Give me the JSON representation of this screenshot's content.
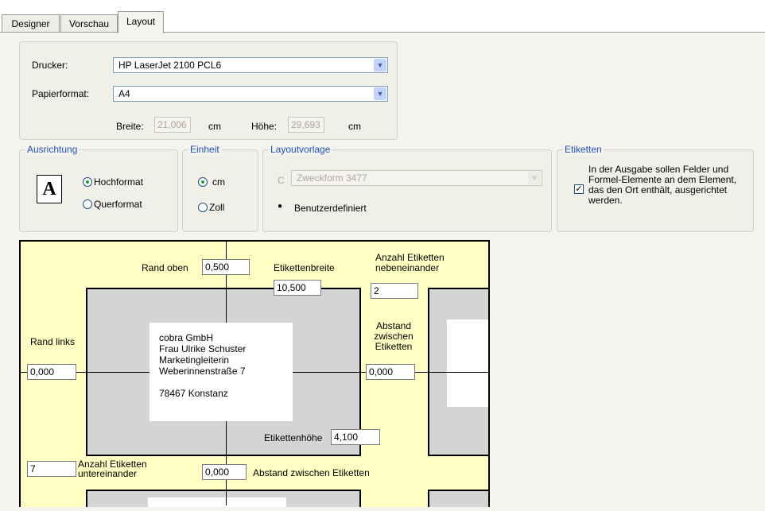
{
  "tabs": [
    "Designer",
    "Vorschau",
    "Layout"
  ],
  "printer": {
    "drucker_label": "Drucker:",
    "drucker_value": "HP LaserJet 2100 PCL6",
    "papier_label": "Papierformat:",
    "papier_value": "A4",
    "breite_label": "Breite:",
    "breite_value": "21,006",
    "hoehe_label": "Höhe:",
    "hoehe_value": "29,693",
    "unit1": "cm",
    "unit2": "cm"
  },
  "ausrichtung": {
    "title": "Ausrichtung",
    "icon_letter": "A",
    "hochformat": "Hochformat",
    "querformat": "Querformat"
  },
  "einheit": {
    "title": "Einheit",
    "cm": "cm",
    "zoll": "Zoll"
  },
  "layoutvorlage": {
    "title": "Layoutvorlage",
    "template_value": "Zweckform 3477",
    "custom": "Benutzerdefiniert"
  },
  "etiketten": {
    "title": "Etiketten",
    "text": "In der Ausgabe sollen Felder und Formel-Elemente an dem Element, das den Ort enthält, ausgerichtet werden."
  },
  "preview": {
    "rand_oben_label": "Rand oben",
    "rand_oben_value": "0,500",
    "etikettenbreite_label": "Etikettenbreite",
    "etikettenbreite_value": "10,500",
    "anzahl_neben_label": "Anzahl Etiketten nebeneinander",
    "anzahl_neben_value": "2",
    "rand_links_label": "Rand links",
    "rand_links_value": "0,000",
    "abstand_label": "Abstand zwischen Etiketten",
    "abstand_value": "0,000",
    "address": [
      "cobra GmbH",
      "Frau Ulrike Schuster",
      "Marketingleiterin",
      "Weberinnenstraße 7",
      "",
      "78467 Konstanz"
    ],
    "etikettenhoehe_label": "Etikettenhöhe",
    "etikettenhoehe_value": "4,100",
    "anzahl_unter_value": "7",
    "anzahl_unter_label": "Anzahl Etiketten untereinander",
    "abstand_vert_value": "0,000",
    "abstand_vert_label": "Abstand zwischen Etiketten"
  }
}
